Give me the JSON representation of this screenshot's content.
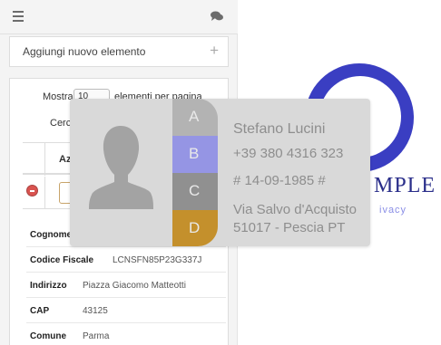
{
  "topbar": {
    "menu_icon": "hamburger-icon",
    "chat_icon": "comments-icon"
  },
  "add_panel": {
    "label": "Aggiungi nuovo elemento",
    "plus": "+"
  },
  "table_controls": {
    "show_label": "Mostra",
    "length_value": "10",
    "entries_label": "elementi per pagina",
    "search_label": "Cerca"
  },
  "table": {
    "header_azioni": "Azioni",
    "details": [
      {
        "key": "Cognome",
        "value": ""
      },
      {
        "key": "Codice Fiscale",
        "value": "LCNSFN85P23G337J"
      },
      {
        "key": "Indirizzo",
        "value": "Piazza Giacomo Matteotti"
      },
      {
        "key": "CAP",
        "value": "43125"
      },
      {
        "key": "Comune",
        "value": "Parma"
      }
    ]
  },
  "background_logo": {
    "text": "MPLE",
    "subtext": "ivacy"
  },
  "contact_card": {
    "tabs": [
      {
        "letter": "A",
        "color": "#b3b3b3"
      },
      {
        "letter": "B",
        "color": "#9595e4"
      },
      {
        "letter": "C",
        "color": "#909090"
      },
      {
        "letter": "D",
        "color": "#c4902c"
      }
    ],
    "name": "Stefano Lucini",
    "phone": "+39 380 4316 323",
    "birth": "# 14-09-1985 #",
    "address_line1": "Via Salvo d'Acquisto",
    "address_line2": "51017 - Pescia PT"
  }
}
